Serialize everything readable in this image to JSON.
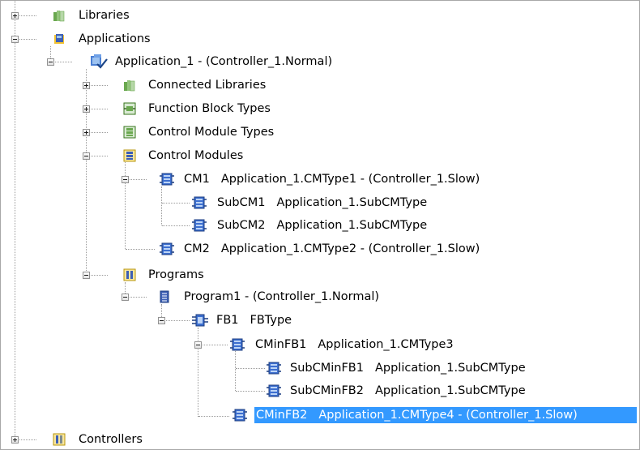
{
  "tree": {
    "libraries": {
      "label": "Libraries",
      "icon": "library-icon"
    },
    "applications": {
      "label": "Applications",
      "icon": "applications-icon"
    },
    "application_1": {
      "label": "Application_1 - (Controller_1.Normal)",
      "icon": "application-check-icon"
    },
    "connected_libraries": {
      "label": "Connected Libraries",
      "icon": "library-icon"
    },
    "fb_types": {
      "label": "Function Block Types",
      "icon": "function-block-types-icon"
    },
    "cm_types": {
      "label": "Control Module Types",
      "icon": "control-module-types-icon"
    },
    "control_modules": {
      "label": "Control Modules",
      "icon": "control-modules-icon"
    },
    "cm1": {
      "name": "CM1",
      "desc": "Application_1.CMType1 - (Controller_1.Slow)",
      "icon": "control-module-icon"
    },
    "subcm1": {
      "name": "SubCM1",
      "desc": "Application_1.SubCMType",
      "icon": "control-module-icon"
    },
    "subcm2": {
      "name": "SubCM2",
      "desc": "Application_1.SubCMType",
      "icon": "control-module-icon"
    },
    "cm2": {
      "name": "CM2",
      "desc": "Application_1.CMType2 - (Controller_1.Slow)",
      "icon": "control-module-icon"
    },
    "programs": {
      "label": "Programs",
      "icon": "programs-icon"
    },
    "program1": {
      "label": "Program1 - (Controller_1.Normal)",
      "icon": "program-icon"
    },
    "fb1": {
      "name": "FB1",
      "desc": "FBType",
      "icon": "function-block-icon"
    },
    "cminfb1": {
      "name": "CMinFB1",
      "desc": "Application_1.CMType3",
      "icon": "control-module-icon"
    },
    "subcminfb1": {
      "name": "SubCMinFB1",
      "desc": "Application_1.SubCMType",
      "icon": "control-module-icon"
    },
    "subcminfb2": {
      "name": "SubCMinFB2",
      "desc": "Application_1.SubCMType",
      "icon": "control-module-icon"
    },
    "cminfb2": {
      "name": "CMinFB2",
      "desc": "Application_1.CMType4 - (Controller_1.Slow)",
      "icon": "control-module-icon",
      "selected": true
    },
    "controllers": {
      "label": "Controllers",
      "icon": "controllers-icon"
    }
  },
  "colors": {
    "selection": "#3399ff",
    "tree_lines": "#9a9a9a"
  }
}
